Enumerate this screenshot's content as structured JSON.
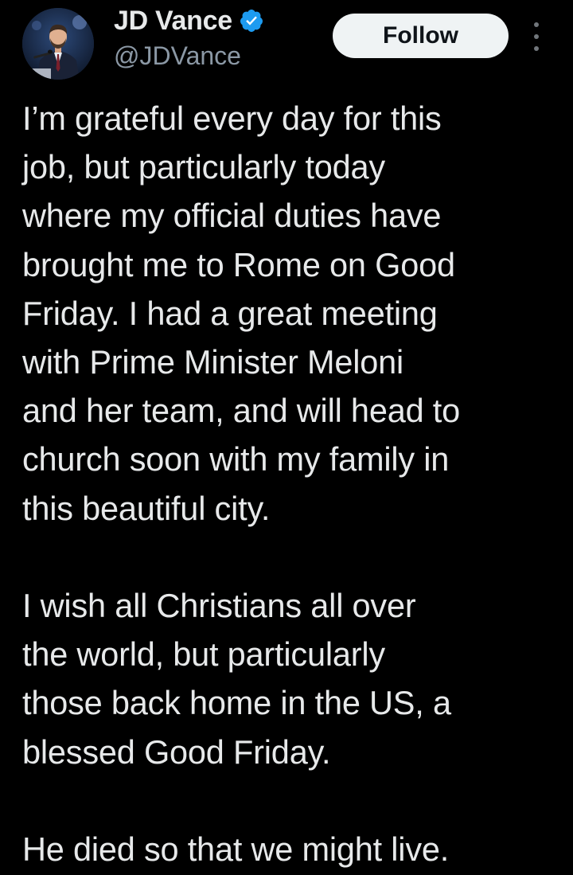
{
  "author": {
    "display_name": "JD Vance",
    "handle": "@JDVance",
    "verified_icon": "verified-badge-icon",
    "verified_color": "#1d9bf0",
    "avatar": "profile-photo"
  },
  "actions": {
    "follow_label": "Follow",
    "more_icon": "more-vertical-icon"
  },
  "tweet": {
    "paragraphs": [
      "I’m grateful every day for this\njob, but particularly today\nwhere my official duties have\nbrought me to Rome on Good\nFriday. I had a great meeting\nwith Prime Minister Meloni\nand her team, and will head to\nchurch soon with my family in\nthis beautiful city.",
      "I wish all Christians all over\nthe world, but particularly\nthose back home in the US, a\nblessed Good Friday.",
      "He died so that we might live."
    ]
  },
  "colors": {
    "background": "#000000",
    "text": "#e7e9ea",
    "secondary_text": "#8b98a5",
    "button_bg": "#eff3f4",
    "button_text": "#0f1419"
  }
}
